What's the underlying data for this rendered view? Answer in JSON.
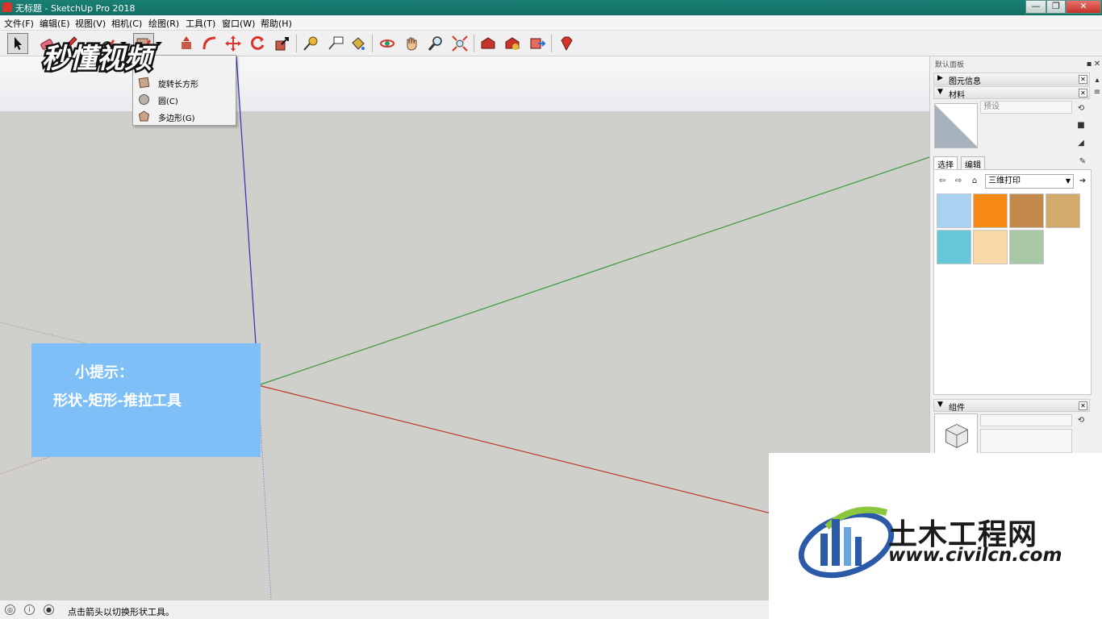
{
  "window": {
    "title": "无标题 - SketchUp Pro 2018",
    "minimize": "—",
    "maximize": "❐",
    "close": "✕"
  },
  "menu": [
    "文件(F)",
    "编辑(E)",
    "视图(V)",
    "相机(C)",
    "绘图(R)",
    "工具(T)",
    "窗口(W)",
    "帮助(H)"
  ],
  "shape_menu": {
    "items": [
      "旋转长方形",
      "圆(C)",
      "多边形(G)"
    ]
  },
  "watermark_top": "秒懂视频",
  "tip": {
    "title": "小提示：",
    "body": "形状-矩形-推拉工具"
  },
  "tray": {
    "title": "默认面板",
    "entity_info": "图元信息",
    "materials": "材料",
    "material_name_placeholder": "预设",
    "tab_select": "选择",
    "tab_edit": "编辑",
    "library": "三维打印",
    "components": "组件",
    "swatch_colors": [
      "#a9d1f0",
      "#f68a14",
      "#c38a4c",
      "#d2aa6c",
      "#65c7d8",
      "#f8d8a6",
      "#a9c9a6"
    ]
  },
  "status": {
    "message": "点击箭头以切换形状工具。"
  },
  "logo": {
    "name": "土木工程网",
    "url": "www.civilcn.com"
  },
  "colors": {
    "titlebar": "#137064",
    "tip_bg": "#7fbff8",
    "axis_blue": "#3a3ab8",
    "axis_green": "#3a9a3a",
    "axis_red": "#c0392b"
  }
}
